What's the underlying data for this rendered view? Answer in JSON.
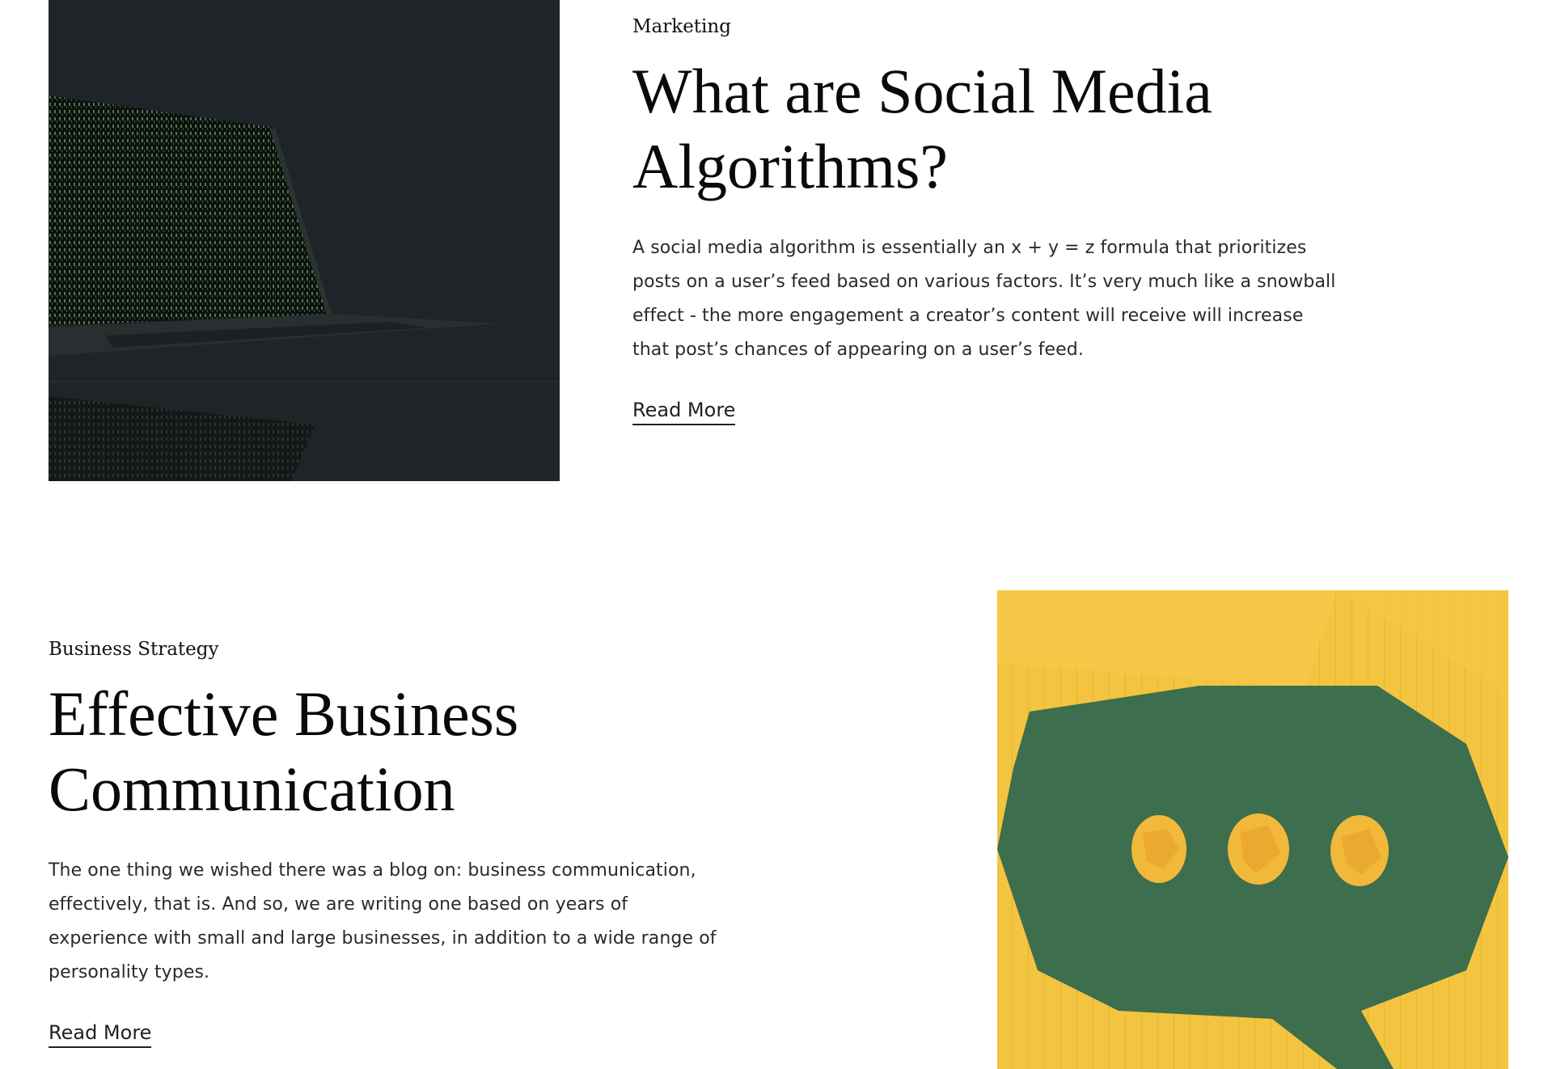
{
  "posts": [
    {
      "category": "Marketing",
      "title": "What are Social Media Algorithms?",
      "excerpt": "A social media algorithm is essentially an x + y = z formula that prioritizes posts on a user’s feed based on various factors. It’s very much like a snowball effect - the more engagement a creator’s content will receive will increase that post’s chances of appearing on a user’s feed.",
      "read_more_label": "Read More",
      "image": "laptop-code-screen-image"
    },
    {
      "category": "Business Strategy",
      "title": "Effective Business Communication",
      "excerpt": "The one thing we wished there was a blog on: business communication, effectively, that is. And so, we are writing one based on years of experience with small and large businesses, in addition to a wide range of personality types.",
      "read_more_label": "Read More",
      "image": "speech-bubble-paper-balls-image"
    }
  ],
  "colors": {
    "text": "#111111",
    "link_underline": "#222222",
    "dark_image_bg": "#1f2428",
    "yellow_paper": "#f3c43f",
    "green_bubble": "#3d6e4d"
  }
}
